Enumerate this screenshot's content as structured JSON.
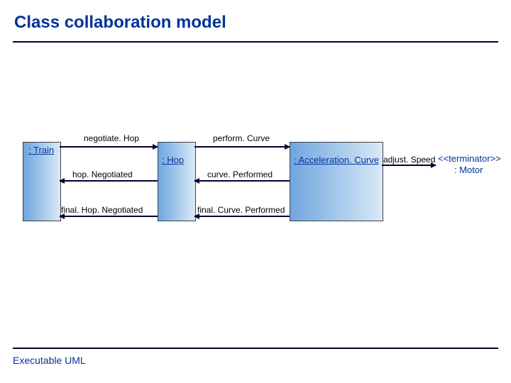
{
  "title": "Class collaboration model",
  "footer": "Executable UML",
  "objects": {
    "train": ": Train",
    "hop": ": Hop",
    "accel": ": Acceleration. Curve",
    "motor_stereo": "<<terminator>>",
    "motor": ": Motor"
  },
  "messages": {
    "negotiateHop": "negotiate. Hop",
    "hopNegotiated": "hop. Negotiated",
    "finalHopNegotiated": "final. Hop. Negotiated",
    "performCurve": "perform. Curve",
    "curvePerformed": "curve. Performed",
    "finalCurvePerformed": "final. Curve. Performed",
    "adjustSpeed": "adjust. Speed"
  }
}
